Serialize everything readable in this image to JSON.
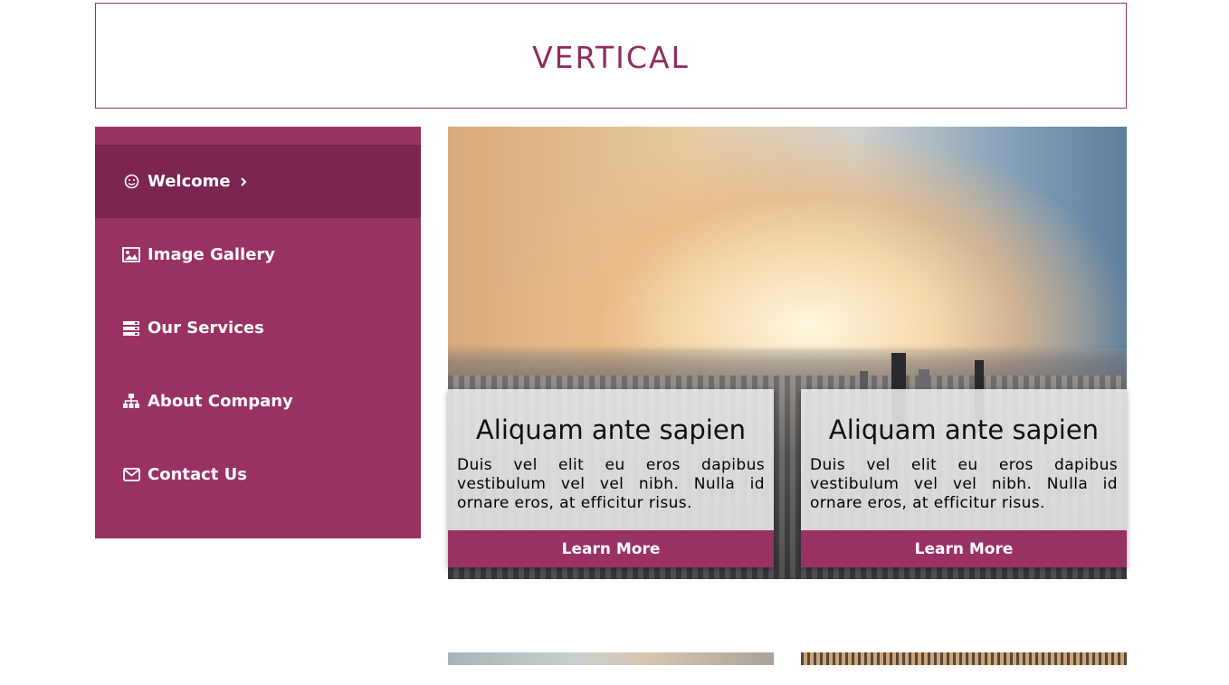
{
  "header": {
    "title": "VERTICAL"
  },
  "sidebar": {
    "items": [
      {
        "label": "Welcome",
        "icon": "smiley-icon",
        "active": true
      },
      {
        "label": "Image Gallery",
        "icon": "image-icon",
        "active": false
      },
      {
        "label": "Our Services",
        "icon": "server-icon",
        "active": false
      },
      {
        "label": "About Company",
        "icon": "sitemap-icon",
        "active": false
      },
      {
        "label": "Contact Us",
        "icon": "envelope-icon",
        "active": false
      }
    ]
  },
  "cards": [
    {
      "title": "Aliquam ante sapien",
      "text": "Duis vel elit eu eros dapibus vestibulum vel vel nibh. Nulla id ornare eros, at efficitur risus.",
      "button": "Learn More"
    },
    {
      "title": "Aliquam ante sapien",
      "text": "Duis vel elit eu eros dapibus vestibulum vel vel nibh. Nulla id ornare eros, at efficitur risus.",
      "button": "Learn More"
    }
  ],
  "colors": {
    "accent": "#9a3163",
    "accent_dark": "#7b2550",
    "title": "#8e2d5c"
  }
}
